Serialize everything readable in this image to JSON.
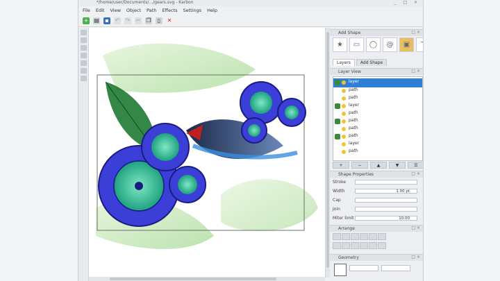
{
  "window": {
    "title": "*/home/user/Documents/.../gears.svg - Karbon"
  },
  "menu": [
    "File",
    "Edit",
    "View",
    "Object",
    "Path",
    "Effects",
    "Settings",
    "Help"
  ],
  "toolbar": {
    "icons": [
      "new-icon",
      "open-icon",
      "save-icon",
      "undo-icon",
      "redo-icon",
      "cut-icon",
      "copy-icon",
      "paste-icon",
      "delete-icon"
    ]
  },
  "dock": {
    "add_shape_title": "Add Shape",
    "shapes": [
      "Star",
      "Rect",
      "Ellipse",
      "Spiral",
      "Image",
      "Text"
    ],
    "tabs": [
      "Layers",
      "Add Shape"
    ],
    "layer_view_title": "Layer View",
    "layers": [
      "layer",
      "path",
      "path",
      "layer",
      "path",
      "path",
      "path",
      "path",
      "layer",
      "path",
      "path"
    ],
    "shape_properties_title": "Shape Properties",
    "props": [
      {
        "label": "Stroke",
        "value": ""
      },
      {
        "label": "Width",
        "value": "1.00 pt"
      },
      {
        "label": "Cap",
        "value": ""
      },
      {
        "label": "Join",
        "value": ""
      },
      {
        "label": "Miter limit",
        "value": "10.00"
      }
    ],
    "arrange_title": "Arrange",
    "geometry_title": "Geometry"
  },
  "colors": {
    "gear_fill": "#3b3fd8",
    "gear_stroke": "#1a1c80",
    "gear_center": "#39c7a8",
    "leaf_green": "#2e8b3d",
    "selection": "#2f7fd6",
    "accent_blue": "#3b6fb6"
  }
}
